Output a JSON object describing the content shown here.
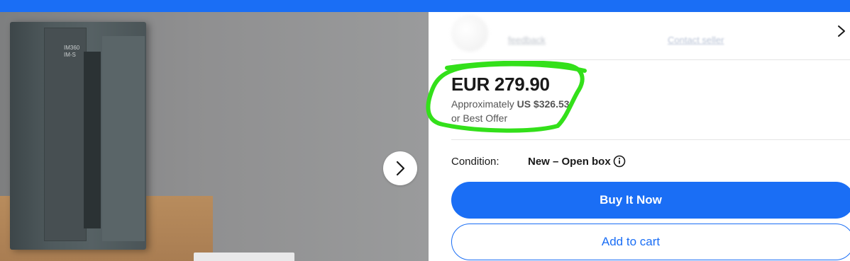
{
  "colors": {
    "brand_blue": "#1a6ef5",
    "annotation_green": "#33e01a"
  },
  "gallery": {
    "module_label": "IM360\nIM-S",
    "next_icon": "chevron-right-icon"
  },
  "seller": {
    "chevron_icon": "chevron-right-icon",
    "name": "feedback",
    "contact": "Contact seller"
  },
  "listing": {
    "price": "EUR 279.90",
    "approx_prefix": "Approximately",
    "approx_value": "US $326.53",
    "best_offer": "or Best Offer",
    "condition_label": "Condition:",
    "condition_value": "New – Open box",
    "condition_info_icon": "info-icon"
  },
  "actions": {
    "buy_now": "Buy It Now",
    "add_to_cart": "Add to cart"
  }
}
